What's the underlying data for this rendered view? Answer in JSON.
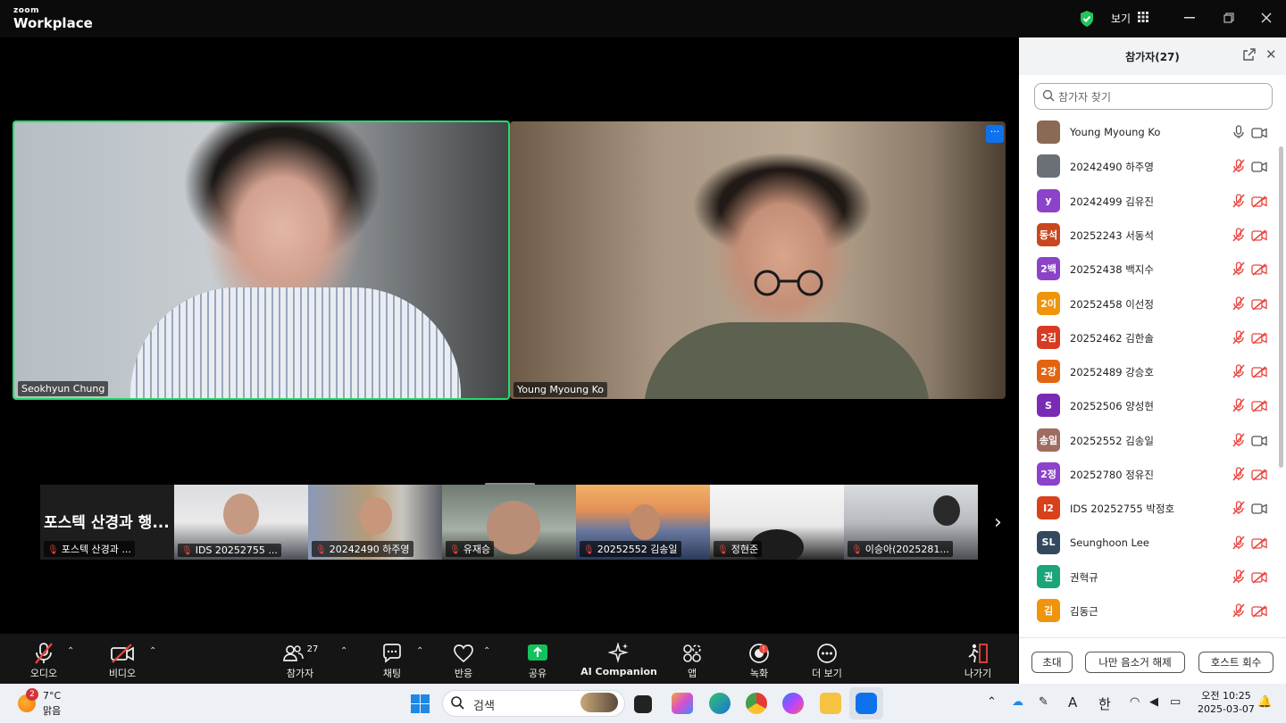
{
  "app": {
    "brand_small": "zoom",
    "brand_big": "Workplace",
    "view_label": "보기"
  },
  "colors": {
    "active_speaker": "#23d96b",
    "accent": "#0e72ed",
    "muted": "#e8463f",
    "toolbar": "#151515"
  },
  "stage": {
    "speakers": [
      {
        "name": "Seokhyun Chung"
      },
      {
        "name": "Young Myoung Ko"
      }
    ],
    "more_label": "···"
  },
  "strip": {
    "tiles": [
      {
        "big_text": "포스텍 산경과 행...",
        "label": "포스텍 산경과 ..."
      },
      {
        "label": "IDS 20252755 ..."
      },
      {
        "label": "20242490 하주영"
      },
      {
        "label": "유재승"
      },
      {
        "label": "20252552 김송일"
      },
      {
        "label": "정현준"
      },
      {
        "label": "이승아(2025281..."
      }
    ],
    "next_icon": "chevron-right-icon"
  },
  "toolbar": {
    "audio": "오디오",
    "video": "비디오",
    "participants": "참가자",
    "participants_count": "27",
    "chat": "채팅",
    "reactions": "반응",
    "share": "공유",
    "ai": "AI Companion",
    "apps": "앱",
    "record": "녹화",
    "more": "더 보기",
    "leave": "나가기"
  },
  "panel": {
    "title": "참가자(27)",
    "search_placeholder": "참가자 찾기",
    "participants": [
      {
        "name": "Young Myoung Ko",
        "avatar": "",
        "avatar_color": "#8a6a52",
        "mic": "on",
        "cam": "on"
      },
      {
        "name": "20242490 하주영",
        "avatar": "",
        "avatar_color": "#6b7077",
        "mic": "muted",
        "cam": "on"
      },
      {
        "name": "20242499 김유진",
        "avatar": "y",
        "avatar_color": "#8c43c9",
        "mic": "muted",
        "cam": "off"
      },
      {
        "name": "20252243 서동석",
        "avatar": "동석",
        "avatar_color": "#c8471f",
        "mic": "muted",
        "cam": "off"
      },
      {
        "name": "20252438 백지수",
        "avatar": "2백",
        "avatar_color": "#8c43c9",
        "mic": "muted",
        "cam": "off"
      },
      {
        "name": "20252458 이선정",
        "avatar": "2이",
        "avatar_color": "#f0940c",
        "mic": "muted",
        "cam": "off"
      },
      {
        "name": "20252462 김한솔",
        "avatar": "2김",
        "avatar_color": "#d93a22",
        "mic": "muted",
        "cam": "off"
      },
      {
        "name": "20252489 강승호",
        "avatar": "2강",
        "avatar_color": "#e3630f",
        "mic": "muted",
        "cam": "off"
      },
      {
        "name": "20252506 양성현",
        "avatar": "S",
        "avatar_color": "#7a2bb5",
        "mic": "muted",
        "cam": "off"
      },
      {
        "name": "20252552 김송일",
        "avatar": "송일",
        "avatar_color": "#a06c60",
        "mic": "muted",
        "cam": "on"
      },
      {
        "name": "20252780 정유진",
        "avatar": "2정",
        "avatar_color": "#8c43c9",
        "mic": "muted",
        "cam": "off"
      },
      {
        "name": "IDS 20252755 박정호",
        "avatar": "I2",
        "avatar_color": "#d8411c",
        "mic": "muted",
        "cam": "on"
      },
      {
        "name": "Seunghoon Lee",
        "avatar": "SL",
        "avatar_color": "#34495e",
        "mic": "muted",
        "cam": "off"
      },
      {
        "name": "권혁규",
        "avatar": "권",
        "avatar_color": "#1aa57a",
        "mic": "muted",
        "cam": "off"
      },
      {
        "name": "김동근",
        "avatar": "김",
        "avatar_color": "#f0940c",
        "mic": "muted",
        "cam": "off"
      }
    ],
    "buttons": {
      "invite": "초대",
      "unmute_me": "나만 음소거 해제",
      "reclaim_host": "호스트 회수"
    }
  },
  "taskbar": {
    "weather_badge": "2",
    "weather_temp": "7°C",
    "weather_cond": "맑음",
    "search": "검색",
    "ime_a": "A",
    "ime_ko": "한",
    "time": "오전 10:25",
    "date": "2025-03-07"
  }
}
